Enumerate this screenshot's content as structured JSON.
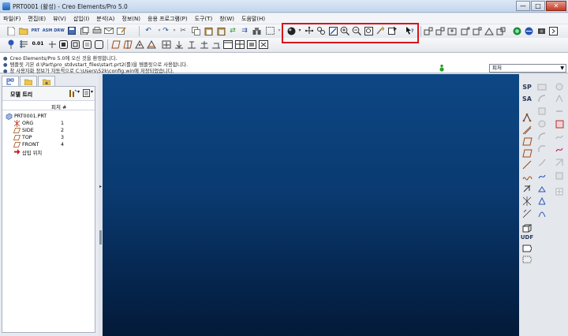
{
  "window": {
    "title": "PRT0001 (활성) - Creo Elements/Pro 5.0",
    "buttons": [
      "—",
      "□",
      "✕"
    ]
  },
  "menubar": {
    "items": [
      "파일(F)",
      "편집(E)",
      "뷰(V)",
      "삽입(I)",
      "분석(A)",
      "정보(N)",
      "응용 프로그램(P)",
      "도구(T)",
      "창(W)",
      "도움말(H)"
    ]
  },
  "toolbar_top": {
    "file_icons": [
      "new-icon",
      "open-icon",
      "prt-icon",
      "asm-icon",
      "drw-icon",
      "save-icon",
      "save-copy-icon",
      "print-icon",
      "email-icon"
    ],
    "file_icon_labels": {
      "prt": "PRT",
      "asm": "ASM",
      "drw": "DRW"
    },
    "edit_icons": [
      "undo-icon",
      "redo-icon",
      "cut-icon",
      "copy-icon",
      "paste-icon",
      "paste-special-icon",
      "regenerate-icon",
      "regen-manager-icon",
      "find-icon",
      "select-box-icon"
    ],
    "view_icons_highlighted": [
      "display-style-icon",
      "spin-center-icon",
      "orient-mode-icon",
      "refit-icon",
      "zoom-in-icon",
      "zoom-out-icon",
      "zoom-fit-icon",
      "repaint-icon",
      "view-manager-icon",
      "context-help-icon"
    ],
    "right_icons": [
      "datum-plane-display-icon",
      "datum-axis-display-icon",
      "point-display-icon",
      "csys-display-icon",
      "annotation-display-icon",
      "spin-center-display-icon",
      "appearance-icon",
      "model-tree-icon",
      "layers-icon"
    ]
  },
  "toolbar_second": {
    "icons": [
      "saved-views-icon",
      "model-settings-icon",
      "precision-icon",
      "layers-toggle-icon",
      "shade-icon",
      "hidden-line-icon",
      "no-hidden-icon",
      "wireframe-icon",
      "datum-plane-icon",
      "datum-axis-icon",
      "datum-point-icon",
      "csys-icon",
      "sketch-icon",
      "note-icon",
      "dimension-icon",
      "table-icon",
      "window-icon",
      "close-window-icon"
    ],
    "precision_label": "0.01"
  },
  "messages": [
    "Creo Elements/Pro 5.0에 오신 것을 환영합니다.",
    "템플릿 기본 d:\\Part\\pro_stdvstart_files\\start.prt2(를)을 템플릿으로 사용합니다.",
    "창 사용자화 정보가 자동적으로 C:\\Users\\52k\\config.win에 저장되었습니다."
  ],
  "filter": {
    "value": "피처"
  },
  "navigator": {
    "tabs": [
      "model-tree-tab-icon",
      "folder-browser-tab-icon",
      "favorites-tab-icon"
    ],
    "title": "모델 트리",
    "column_header": "피처 #",
    "rows": [
      {
        "icon": "part-icon",
        "label": "PRT0001.PRT",
        "value": ""
      },
      {
        "icon": "csys-icon",
        "label": "ORG",
        "value": "1"
      },
      {
        "icon": "datum-plane-icon",
        "label": "SIDE",
        "value": "2"
      },
      {
        "icon": "datum-plane-icon",
        "label": "TOP",
        "value": "3"
      },
      {
        "icon": "datum-plane-icon",
        "label": "FRONT",
        "value": "4"
      },
      {
        "icon": "insert-here-icon",
        "label": "삽입 위치",
        "value": ""
      }
    ]
  },
  "right_toolbar": {
    "labels": {
      "sp": "SP",
      "sa": "SA",
      "udf": "UDF"
    }
  },
  "colors": {
    "highlight": "#d8141b",
    "graphics_top": "#0d4785",
    "graphics_bottom": "#031a38"
  }
}
